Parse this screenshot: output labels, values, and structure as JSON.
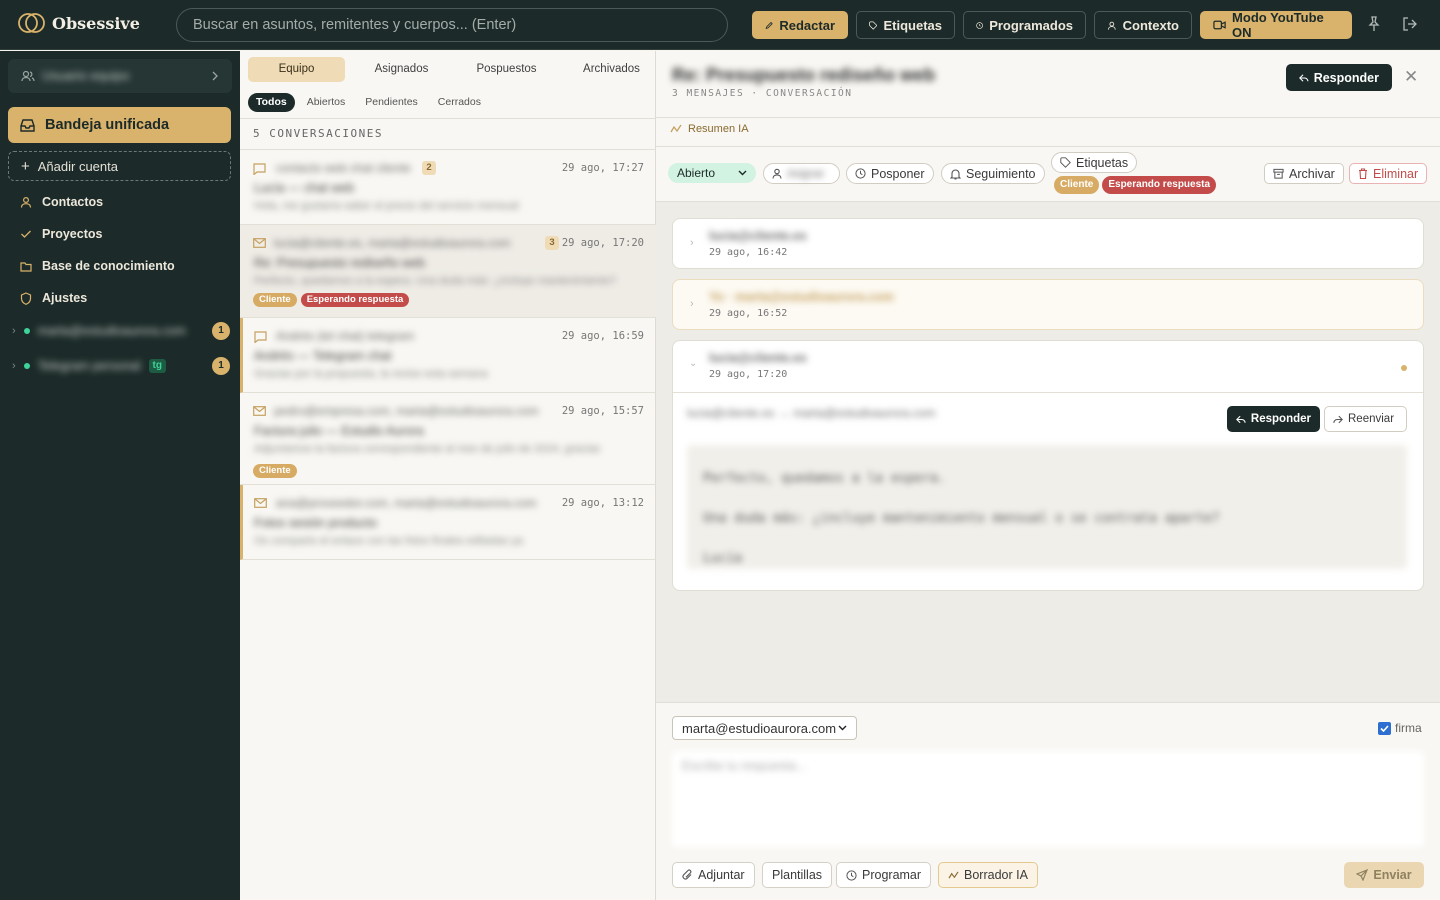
{
  "app": {
    "name": "Obsessive"
  },
  "topbar": {
    "search_placeholder": "Buscar en asuntos, remitentes y cuerpos... (Enter)",
    "buttons": {
      "compose": "Redactar",
      "labels": "Etiquetas",
      "scheduled": "Programados",
      "context": "Contexto",
      "youtube": "Modo YouTube ON"
    }
  },
  "sidebar": {
    "account_name": "Usuario equipo",
    "unified": "Bandeja unificada",
    "add_account": "Añadir cuenta",
    "nav": [
      "Contactos",
      "Proyectos",
      "Base de conocimiento",
      "Ajustes"
    ],
    "accounts": [
      {
        "name": "marta@estudioaurora.com",
        "count": "1"
      },
      {
        "name": "Telegram personal",
        "tag": "tg",
        "count": "1"
      }
    ]
  },
  "list": {
    "tabs": [
      "Equipo",
      "Asignados",
      "Pospuestos",
      "Archivados"
    ],
    "filters": [
      "Todos",
      "Abiertos",
      "Pendientes",
      "Cerrados"
    ],
    "count_label": "5 CONVERSACIONES",
    "conversations": [
      {
        "from": "contacto web chat cliente",
        "num": "2",
        "time": "29 ago, 17:27",
        "subject": "Lucía — chat web",
        "preview": "Hola, me gustaría saber el precio del servicio mensual"
      },
      {
        "from": "lucia@cliente.es, marta@estudioaurora.com",
        "num": "3",
        "time": "29 ago, 17:20",
        "subject": "Re: Presupuesto rediseño web",
        "preview": "Perfecto, quedamos a la espera. Una duda más: ¿incluye mantenimiento?",
        "badges": [
          "Cliente",
          "Esperando respuesta"
        ]
      },
      {
        "from": "Andrés (tel chat) telegram",
        "time": "29 ago, 16:59",
        "subject": "Andrés — Telegram chat",
        "preview": "Gracias por la propuesta, la reviso esta semana"
      },
      {
        "from": "pedro@empresa.com, marta@estudioaurora.com",
        "time": "29 ago, 15:57",
        "subject": "Factura julio — Estudio Aurora",
        "preview": "Adjuntamos la factura correspondiente al mes de julio de 2024, gracias",
        "badges": [
          "Cliente"
        ]
      },
      {
        "from": "ana@proveedor.com, marta@estudioaurora.com",
        "time": "29 ago, 13:12",
        "subject": "Fotos sesión producto",
        "preview": "Os comparto el enlace con las fotos finales editadas ya"
      }
    ]
  },
  "detail": {
    "title": "Re: Presupuesto rediseño web",
    "meta": "3 MENSAJES · CONVERSACIÓN",
    "reply": "Responder",
    "ai_summary": "Resumen IA",
    "status": "Abierto",
    "assignee": "Asignar",
    "actions": {
      "snooze": "Posponer",
      "follow": "Seguimiento",
      "labels": "Etiquetas",
      "archive": "Archivar",
      "delete": "Eliminar"
    },
    "labels": [
      "Cliente",
      "Esperando respuesta"
    ],
    "messages": [
      {
        "from": "lucia@cliente.es",
        "time": "29 ago, 16:42"
      },
      {
        "from": "Yo · marta@estudioaurora.com",
        "time": "29 ago, 16:52"
      },
      {
        "from": "lucia@cliente.es",
        "time": "29 ago, 17:20"
      }
    ],
    "expanded": {
      "to": "lucia@cliente.es → marta@estudioaurora.com",
      "reply": "Responder",
      "forward": "Reenviar",
      "body": [
        "Perfecto, quedamos a la espera.",
        "Una duda más: ¿incluye mantenimiento mensual o se contrata aparte?",
        "Lucía"
      ]
    }
  },
  "composer": {
    "from": "marta@estudioaurora.com",
    "signature": "firma",
    "placeholder": "Escribe tu respuesta...",
    "buttons": {
      "attach": "Adjuntar",
      "templates": "Plantillas",
      "schedule": "Programar",
      "ai": "Borrador IA",
      "send": "Enviar"
    }
  }
}
